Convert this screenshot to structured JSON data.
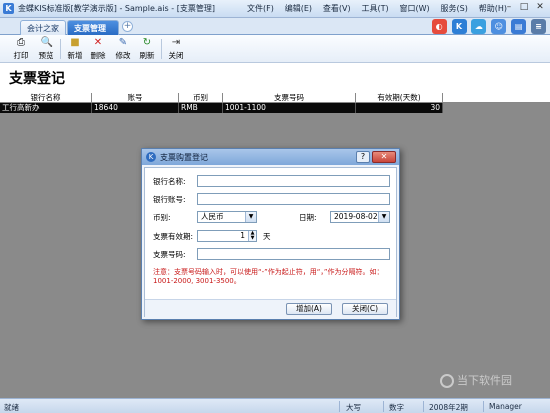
{
  "window": {
    "title": "金蝶KIS标准版[教学演示版] - Sample.ais - [支票管理]",
    "menus": [
      "文件(F)",
      "编辑(E)",
      "查看(V)",
      "工具(T)",
      "窗口(W)",
      "服务(S)",
      "帮助(H)"
    ]
  },
  "tabs": [
    {
      "label": "会计之家"
    },
    {
      "label": "支票管理",
      "close": "✕"
    }
  ],
  "tab_add": "+",
  "toolbar": {
    "print": "打印",
    "preview": "预览",
    "add": "新增",
    "delete": "删除",
    "edit": "修改",
    "refresh": "刷新",
    "close": "关闭"
  },
  "page": {
    "title": "支票登记"
  },
  "grid": {
    "columns": [
      "银行名称",
      "账号",
      "币别",
      "支票号码",
      "有效期(天数)"
    ],
    "rows": [
      {
        "bank": "工行高新办",
        "account": "18640",
        "currency": "RMB",
        "check_no": "1001-1100",
        "valid_days": "30"
      }
    ]
  },
  "dialog": {
    "title": "支票购置登记",
    "help": "?",
    "close": "✕",
    "fields": {
      "bank_name_label": "银行名称:",
      "bank_name_value": "",
      "account_label": "银行账号:",
      "account_value": "",
      "currency_label": "币别:",
      "currency_value": "人民币",
      "date_label": "日期:",
      "date_value": "2019-08-02",
      "validity_label": "支票有效期:",
      "validity_value": "1",
      "validity_unit": "天",
      "check_no_label": "支票号码:",
      "check_no_value": ""
    },
    "note": "注意：支票号码输入时，可以使用“-”作为起止符，用“，”作为分隔符。如：1001-2000, 3001-3500。",
    "buttons": {
      "add": "增加(A)",
      "close": "关闭(C)"
    }
  },
  "status": {
    "ready": "就绪",
    "caps": "大写",
    "num": "数字",
    "period": "2008年2期",
    "user": "Manager"
  },
  "watermark": "当下软件园",
  "colors": {
    "accent": "#2a6cc4",
    "grid_bg": "#8a8a8a",
    "selected_row": "#0a0a0a",
    "note_red": "#c81818"
  }
}
